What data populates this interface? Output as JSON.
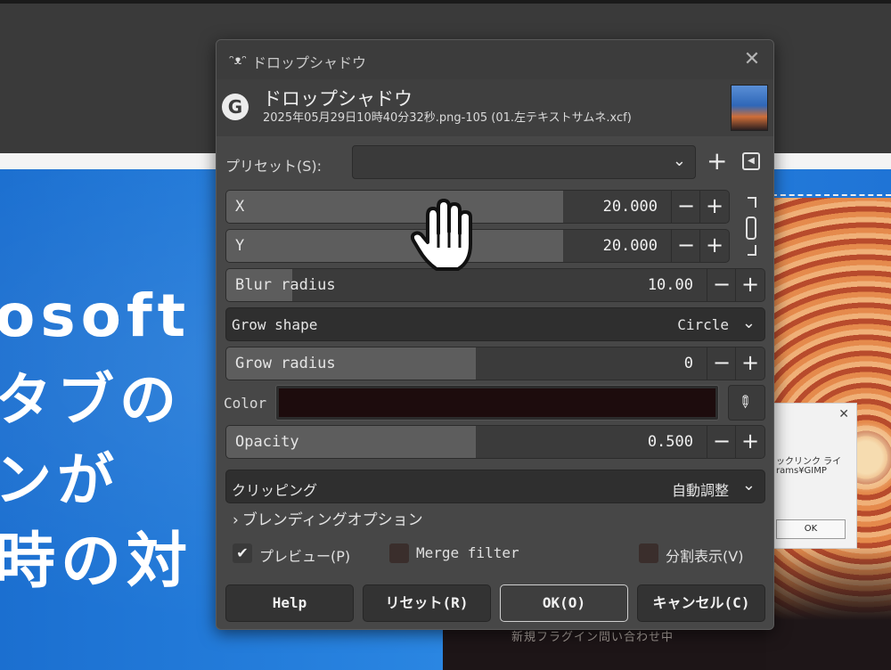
{
  "background": {
    "lines": [
      "osoft E",
      "タブの",
      "ンが",
      "時の対"
    ],
    "bottom_text": "新規フラグイン問い合わせ中",
    "popup": {
      "text1": "ックリンク ライ",
      "text2": "rams¥GIMP",
      "ok": "OK"
    }
  },
  "dialog": {
    "window_title": "ドロップシャドウ",
    "header_title": "ドロップシャドウ",
    "header_subtitle": "2025年05月29日10時40分32秒.png-105 (01.左テキストサムネ.xcf)",
    "preset_label": "プリセット(S):",
    "preset_value": "",
    "x": {
      "label": "X",
      "value": "20.000",
      "fill_fraction": 0.6
    },
    "y": {
      "label": "Y",
      "value": "20.000",
      "fill_fraction": 0.6
    },
    "blur": {
      "label": "Blur radius",
      "value": "10.00",
      "fill_fraction": 0.12
    },
    "grow_shape": {
      "label": "Grow shape",
      "value": "Circle"
    },
    "grow_radius": {
      "label": "Grow radius",
      "value": "0",
      "fill_fraction": 0.5
    },
    "color": {
      "label": "Color",
      "value": "#1d0c0d"
    },
    "opacity": {
      "label": "Opacity",
      "value": "0.500",
      "fill_fraction": 0.5
    },
    "clipping": {
      "label": "クリッピング",
      "value": "自動調整"
    },
    "blending": "ブレンディングオプション",
    "preview": {
      "label": "プレビュー(P)",
      "checked": true
    },
    "merge_filter": {
      "label": "Merge filter",
      "checked": false
    },
    "split_view": {
      "label": "分割表示(V)",
      "checked": false
    },
    "buttons": {
      "help": "Help",
      "reset": "リセット(R)",
      "ok": "OK(O)",
      "cancel": "キャンセル(C)"
    }
  },
  "colors": {
    "accent_blue": "#2a86e2",
    "dialog_bg": "#474747",
    "shadow_color": "#1d0c0d"
  },
  "icons": {
    "cursor": "hand-cursor-icon",
    "chain": "chain-link-icon",
    "picker": "eyedropper-icon"
  }
}
